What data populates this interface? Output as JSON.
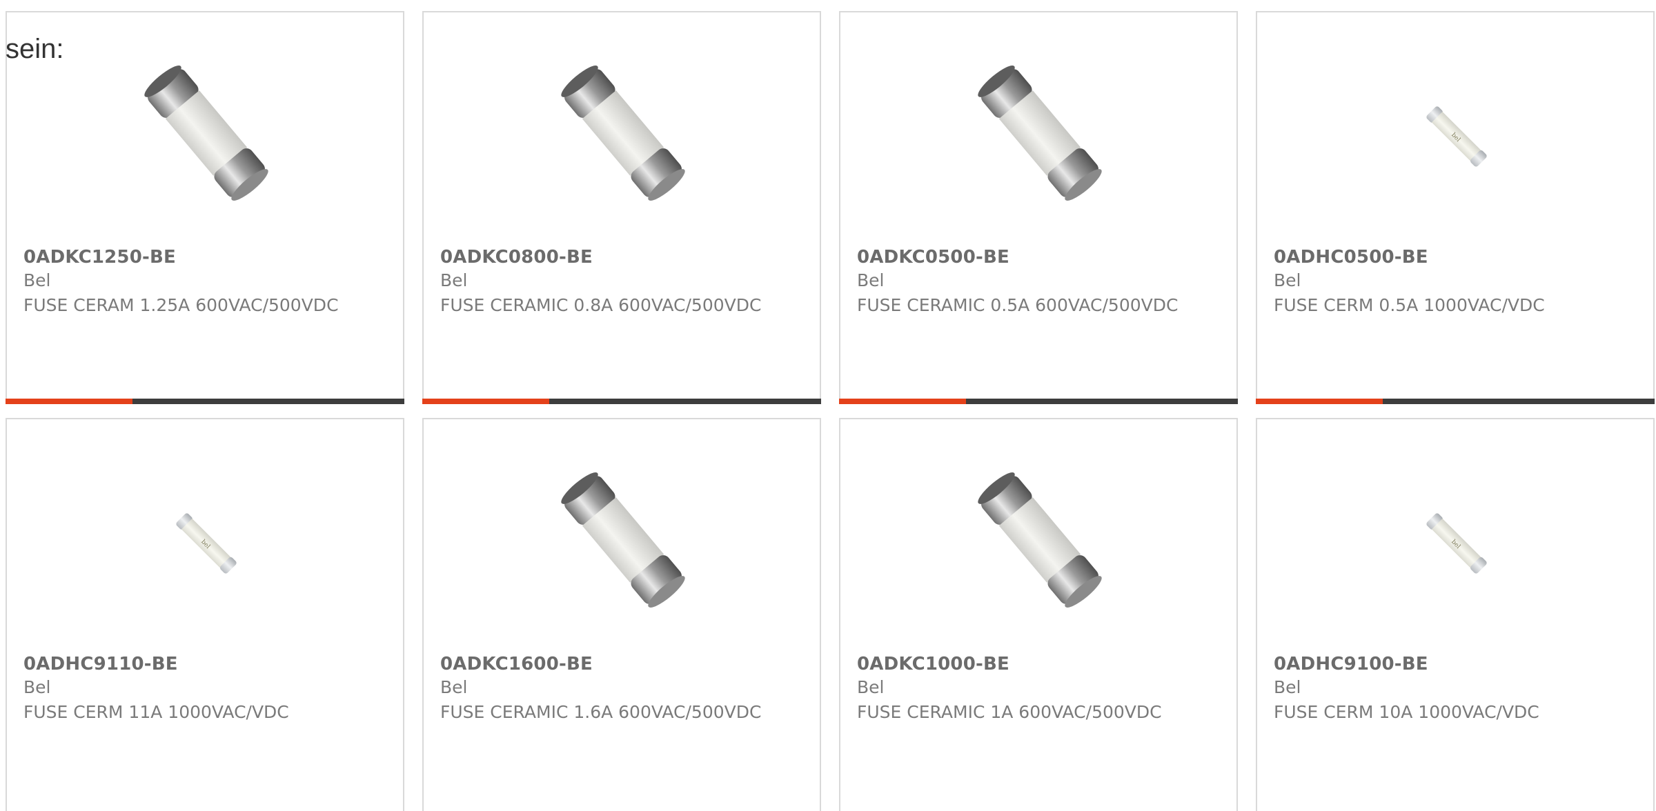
{
  "intro": "sein:",
  "colors": {
    "accent": "#e4411a",
    "bar_dark": "#3d3d3d",
    "border": "#d9d9d9",
    "text": "#7a7a7a"
  },
  "products": [
    {
      "part_number": "0ADKC1250-BE",
      "manufacturer": "Bel",
      "description": "FUSE CERAM 1.25A 600VAC/500VDC",
      "image": "ceramic-fuse-large-icon"
    },
    {
      "part_number": "0ADKC0800-BE",
      "manufacturer": "Bel",
      "description": "FUSE CERAMIC 0.8A 600VAC/500VDC",
      "image": "ceramic-fuse-large-icon"
    },
    {
      "part_number": "0ADKC0500-BE",
      "manufacturer": "Bel",
      "description": "FUSE CERAMIC 0.5A 600VAC/500VDC",
      "image": "ceramic-fuse-large-icon"
    },
    {
      "part_number": "0ADHC0500-BE",
      "manufacturer": "Bel",
      "description": "FUSE CERM 0.5A 1000VAC/VDC",
      "image": "ceramic-fuse-small-icon"
    },
    {
      "part_number": "0ADHC9110-BE",
      "manufacturer": "Bel",
      "description": "FUSE CERM 11A 1000VAC/VDC",
      "image": "ceramic-fuse-small-icon"
    },
    {
      "part_number": "0ADKC1600-BE",
      "manufacturer": "Bel",
      "description": "FUSE CERAMIC 1.6A 600VAC/500VDC",
      "image": "ceramic-fuse-large-icon"
    },
    {
      "part_number": "0ADKC1000-BE",
      "manufacturer": "Bel",
      "description": "FUSE CERAMIC 1A 600VAC/500VDC",
      "image": "ceramic-fuse-large-icon"
    },
    {
      "part_number": "0ADHC9100-BE",
      "manufacturer": "Bel",
      "description": "FUSE CERM 10A 1000VAC/VDC",
      "image": "ceramic-fuse-small-icon"
    }
  ]
}
